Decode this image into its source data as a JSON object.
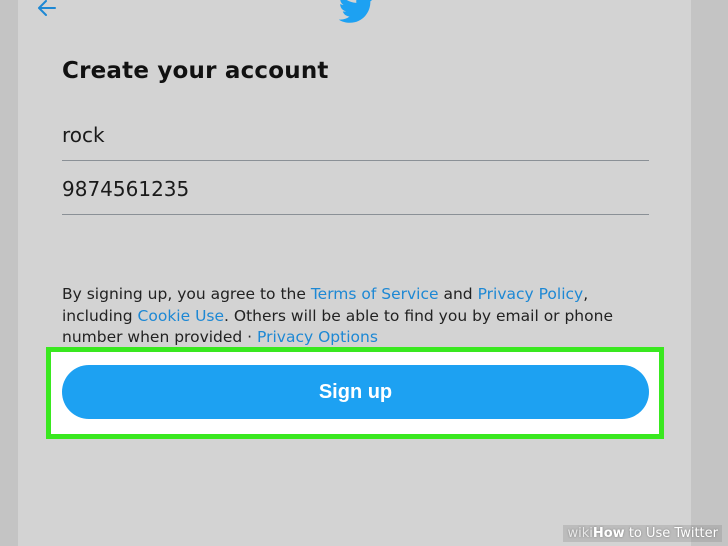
{
  "header": {
    "back_icon": "back-arrow-icon",
    "logo_icon": "twitter-bird-icon"
  },
  "form": {
    "title": "Create your account",
    "name_value": "rock",
    "phone_value": "9874561235"
  },
  "legal": {
    "part1": "By signing up, you agree to the ",
    "terms_link": "Terms of Service",
    "part2": " and ",
    "privacy_link": "Privacy Policy",
    "part3": ", including ",
    "cookie_link": "Cookie Use",
    "part4": ". Others will be able to find you by email or phone number when provided · ",
    "privacy_options_link": "Privacy Options"
  },
  "signup_button": {
    "label": "Sign up"
  },
  "watermark": {
    "wiki": "wiki",
    "how": "How",
    "rest": " to Use Twitter"
  },
  "colors": {
    "accent": "#1da1f2",
    "link": "#1d88d4",
    "highlight": "#39e81f",
    "panel": "#d3d3d3"
  }
}
